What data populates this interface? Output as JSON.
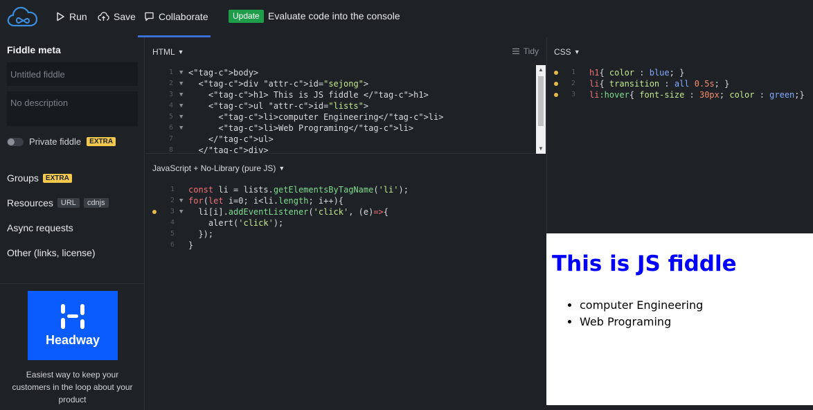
{
  "header": {
    "run_label": "Run",
    "save_label": "Save",
    "collaborate_label": "Collaborate",
    "update_badge": "Update",
    "update_text": "Evaluate code into the console"
  },
  "sidebar": {
    "title": "Fiddle meta",
    "title_placeholder": "Untitled fiddle",
    "description_placeholder": "No description",
    "private_label": "Private fiddle",
    "extra_badge": "EXTRA",
    "groups_label": "Groups",
    "resources_label": "Resources",
    "resources_tags": [
      "URL",
      "cdnjs"
    ],
    "async_label": "Async requests",
    "other_label": "Other (links, license)",
    "ad_brand": "Headway",
    "ad_text": "Easiest way to keep your customers in the loop about your product"
  },
  "html_pane": {
    "label": "HTML",
    "tidy_label": "Tidy",
    "lines": [
      {
        "n": "1",
        "fold": true,
        "code": "<body>"
      },
      {
        "n": "2",
        "fold": true,
        "code": "  <div id=\"sejong\">"
      },
      {
        "n": "3",
        "fold": true,
        "code": "    <h1> This is JS fiddle </h1>"
      },
      {
        "n": "4",
        "fold": true,
        "code": "    <ul id=\"lists\">"
      },
      {
        "n": "5",
        "fold": true,
        "code": "      <li>computer Engineering</li>"
      },
      {
        "n": "6",
        "fold": true,
        "code": "      <li>Web Programing</li>"
      },
      {
        "n": "7",
        "fold": false,
        "code": "    </ul>"
      },
      {
        "n": "8",
        "fold": false,
        "code": "  </div>"
      }
    ]
  },
  "js_pane": {
    "label": "JavaScript + No-Library (pure JS)",
    "lines": [
      {
        "n": "1",
        "dot": false,
        "fold": false,
        "code": "const li = lists.getElementsByTagName('li');"
      },
      {
        "n": "2",
        "dot": false,
        "fold": true,
        "code": "for(let i=0; i<li.length; i++){"
      },
      {
        "n": "3",
        "dot": true,
        "fold": true,
        "code": "  li[i].addEventListener('click', (e)=>{"
      },
      {
        "n": "4",
        "dot": false,
        "fold": false,
        "code": "    alert('click');"
      },
      {
        "n": "5",
        "dot": false,
        "fold": false,
        "code": "  });"
      },
      {
        "n": "6",
        "dot": false,
        "fold": false,
        "code": "}"
      }
    ]
  },
  "css_pane": {
    "label": "CSS",
    "lines": [
      {
        "n": "1",
        "dot": true,
        "code": "h1{ color : blue; }"
      },
      {
        "n": "2",
        "dot": true,
        "code": "li{ transition : all 0.5s; }"
      },
      {
        "n": "3",
        "dot": true,
        "code": "li:hover{ font-size : 30px; color : green;}"
      }
    ]
  },
  "result": {
    "heading": "This is JS fiddle",
    "items": [
      "computer Engineering",
      "Web Programing"
    ]
  },
  "colors": {
    "accent": "#3b6fd8",
    "update_green": "#1f9d4b",
    "extra_yellow": "#f2c94c",
    "headway_blue": "#0b5cff"
  }
}
